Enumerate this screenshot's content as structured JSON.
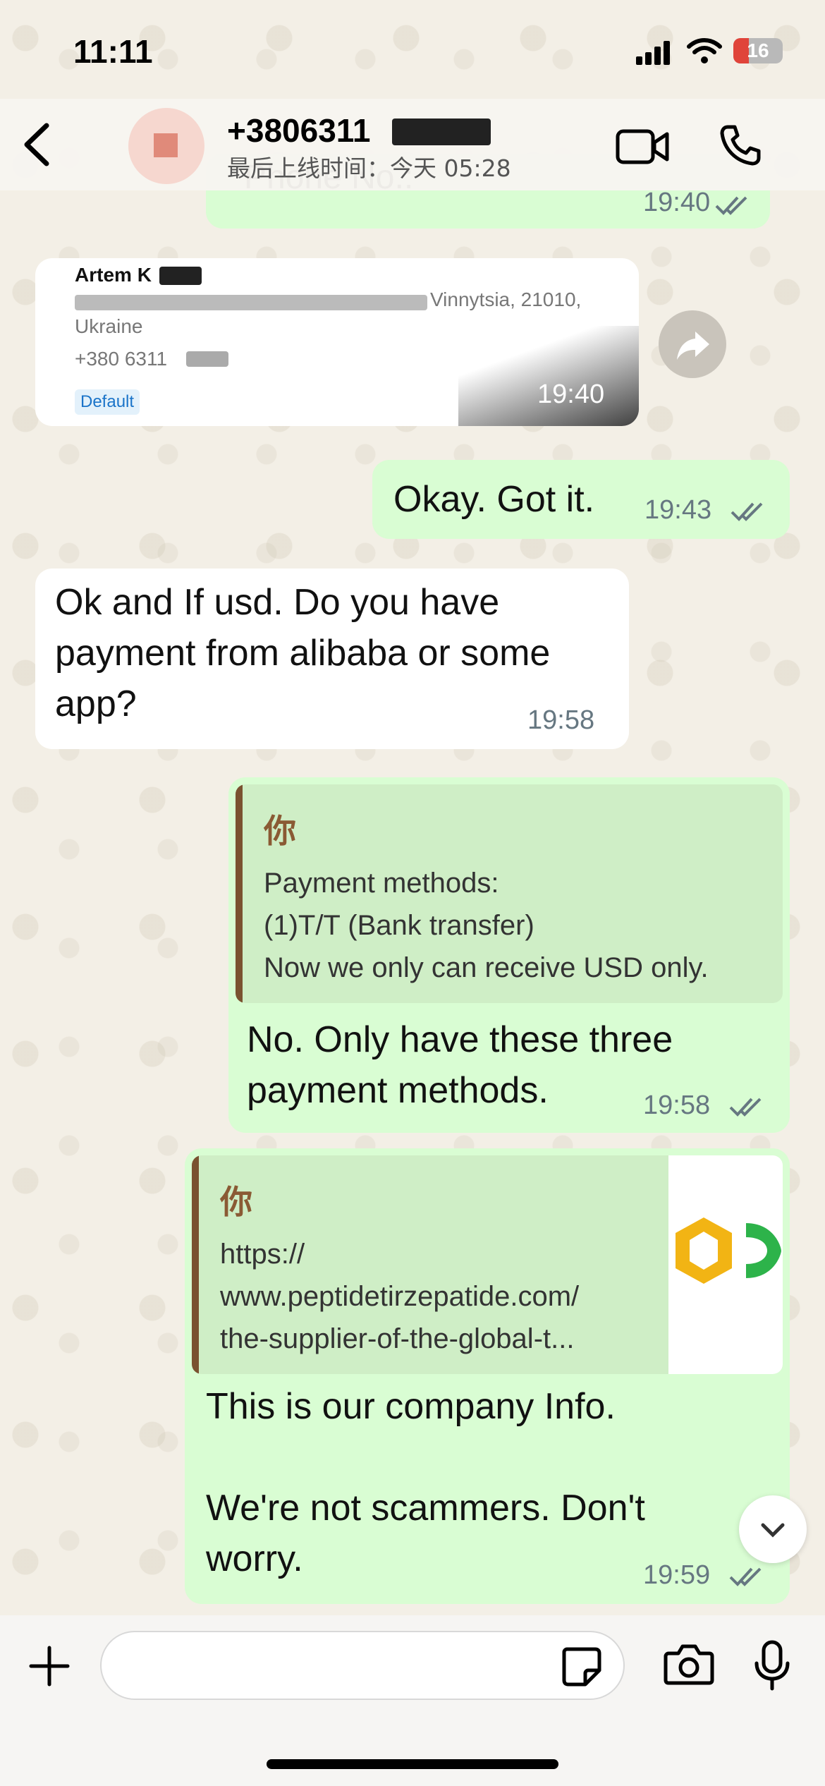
{
  "status_bar": {
    "time": "11:11",
    "battery": "16"
  },
  "header": {
    "name": "+3806311",
    "last_seen": "最后上线时间：今天 05:28"
  },
  "messages": [
    {
      "type": "out",
      "text": "Phone No.:",
      "time": "19:40"
    },
    {
      "type": "in-contact",
      "name": "Artem K",
      "address_line1": "Vinnytsia, 21010,",
      "address_line2": "Ukraine",
      "phone": "+380 6311",
      "badge": "Default",
      "time": "19:40"
    },
    {
      "type": "out",
      "text": "Okay. Got it.",
      "time": "19:43"
    },
    {
      "type": "in",
      "lines": [
        "Ok and If usd. Do you have",
        "payment from alibaba or some",
        "app?"
      ],
      "time": "19:58"
    },
    {
      "type": "out-reply",
      "quote_author": "你",
      "quote_lines": [
        "Payment methods:",
        "(1)T/T (Bank transfer)",
        "Now we only can receive USD only."
      ],
      "lines": [
        "No. Only have these three",
        "payment methods."
      ],
      "time": "19:58"
    },
    {
      "type": "out-link",
      "quote_author": "你",
      "quote_lines": [
        "https://",
        "www.peptidetirzepatide.com/",
        "the-supplier-of-the-global-t..."
      ],
      "lines": [
        "This is our company Info.",
        "",
        "We're not scammers. Don't",
        "worry."
      ],
      "time": "19:59"
    }
  ],
  "input": {
    "placeholder": ""
  },
  "colors": {
    "outgoing": "#d9fdd3",
    "incoming": "#ffffff",
    "quote_accent": "#7a5230"
  }
}
